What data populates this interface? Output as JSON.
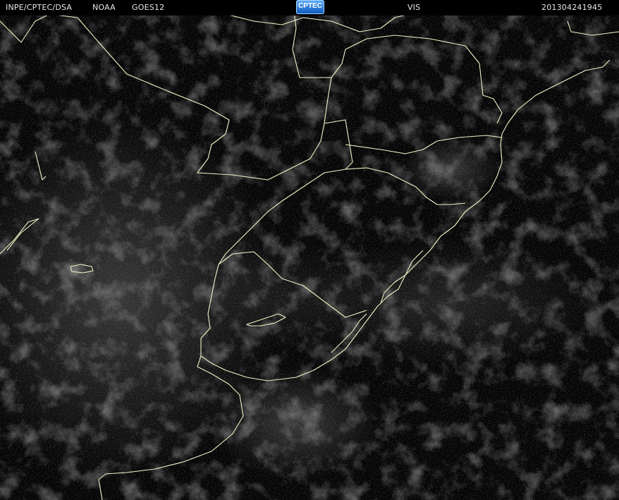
{
  "header": {
    "agency": "INPE/CPTEC/DSA",
    "provider": "NOAA",
    "satellite": "GOES12",
    "band": "VIS",
    "timestamp": "201304241945"
  },
  "logo": {
    "text": "CPTEC",
    "icon": "cptec-logo-icon",
    "color": "#1a6fd6"
  },
  "imagery": {
    "type": "visible satellite image",
    "border_color": "#f2f2c8",
    "background_color": "#000000"
  }
}
